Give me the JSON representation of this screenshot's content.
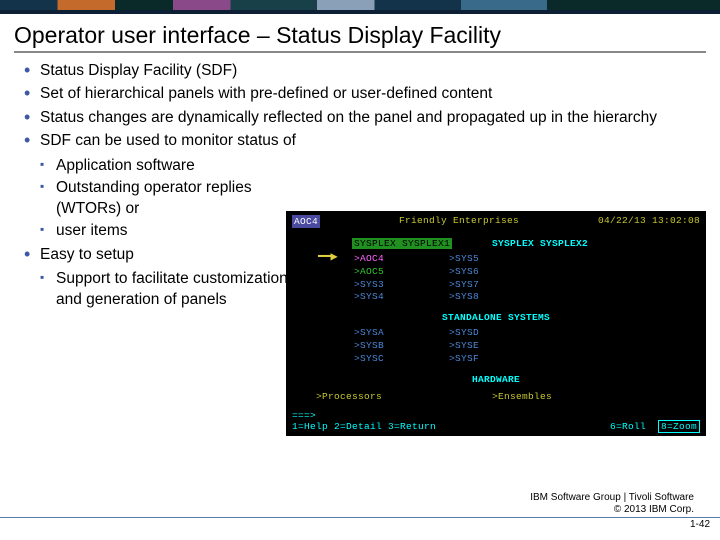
{
  "slide": {
    "title": "Operator user interface – Status Display Facility",
    "bullets": {
      "b1": "Status Display Facility (SDF)",
      "b2": "Set of hierarchical panels with pre-defined or user-defined content",
      "b3": "Status changes are dynamically reflected on the panel and propagated up in the hierarchy",
      "b4": "SDF can be used to monitor status of",
      "b4_sub": {
        "s1": "Application software",
        "s2": "Outstanding operator replies (WTORs) or",
        "s3": "user items"
      },
      "b5": "Easy to setup",
      "b5_sub": {
        "s1": "Support to facilitate customization and generation of panels"
      }
    }
  },
  "terminal": {
    "top_left": "AOC4",
    "top_title": "Friendly Enterprises",
    "top_right": "04/22/13 13:02:08",
    "sysplex1": "SYSPLEX SYSPLEX1",
    "sysplex2": "SYSPLEX SYSPLEX2",
    "col1": {
      "r1": ">AOC4",
      "r2": ">AOC5",
      "r3": ">SYS3",
      "r4": ">SYS4"
    },
    "col2": {
      "r1": ">SYS5",
      "r2": ">SYS6",
      "r3": ">SYS7",
      "r4": ">SYS8"
    },
    "standalone_header": "STANDALONE SYSTEMS",
    "col3": {
      "r1": ">SYSA",
      "r2": ">SYSB",
      "r3": ">SYSC"
    },
    "col4": {
      "r1": ">SYSD",
      "r2": ">SYSE",
      "r3": ">SYSF"
    },
    "hardware_header": "HARDWARE",
    "hw1": ">Processors",
    "hw2": ">Ensembles",
    "prompt": "===>",
    "fn_left": "1=Help 2=Detail 3=Return",
    "fn_mid": "6=Roll",
    "fn_right": "8=Zoom"
  },
  "footer": {
    "line1": "IBM Software Group | Tivoli Software",
    "line2": "© 2013 IBM Corp.",
    "pagenum": "1-42"
  }
}
